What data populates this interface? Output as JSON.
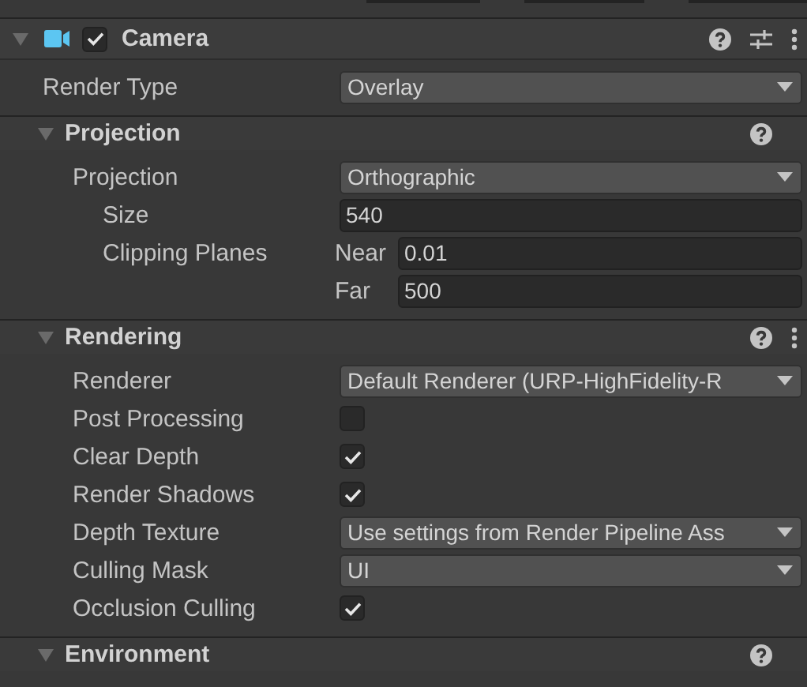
{
  "component": {
    "title": "Camera",
    "enabled": true,
    "expanded": true,
    "fields": [
      {
        "label": "Render Type",
        "kind": "dropdown",
        "value": "Overlay"
      }
    ]
  },
  "sections": [
    {
      "title": "Projection",
      "expanded": true,
      "menu": false,
      "fields": [
        {
          "label": "Projection",
          "kind": "dropdown",
          "value": "Orthographic",
          "children": [
            {
              "label": "Size",
              "kind": "number",
              "value": "540"
            },
            {
              "label": "Clipping Planes",
              "kind": "pair",
              "items": [
                {
                  "label": "Near",
                  "value": "0.01"
                },
                {
                  "label": "Far",
                  "value": "500"
                }
              ]
            }
          ]
        }
      ]
    },
    {
      "title": "Rendering",
      "expanded": true,
      "menu": true,
      "fields": [
        {
          "label": "Renderer",
          "kind": "dropdown",
          "value": "Default Renderer (URP-HighFidelity-R"
        },
        {
          "label": "Post Processing",
          "kind": "checkbox",
          "checked": false
        },
        {
          "label": "Clear Depth",
          "kind": "checkbox",
          "checked": true
        },
        {
          "label": "Render Shadows",
          "kind": "checkbox",
          "checked": true
        },
        {
          "label": "Depth Texture",
          "kind": "dropdown",
          "value": "Use settings from Render Pipeline Ass"
        },
        {
          "label": "Culling Mask",
          "kind": "dropdown",
          "value": "UI"
        },
        {
          "label": "Occlusion Culling",
          "kind": "checkbox",
          "checked": true
        }
      ]
    },
    {
      "title": "Environment",
      "expanded": true,
      "menu": false
    }
  ]
}
